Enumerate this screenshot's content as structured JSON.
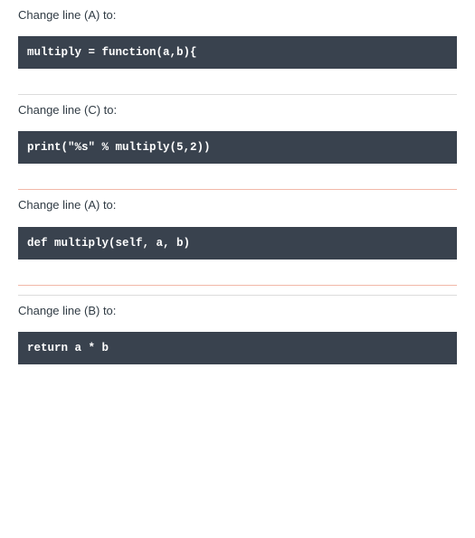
{
  "options": [
    {
      "prompt": "Change line (A) to:",
      "code": "multiply = function(a,b){"
    },
    {
      "prompt": "Change line (C) to:",
      "code": "print(\"%s\" % multiply(5,2))"
    },
    {
      "prompt": "Change line (A) to:",
      "code": "def multiply(self, a, b)"
    },
    {
      "prompt": "Change line (B) to:",
      "code": "return a * b"
    }
  ]
}
